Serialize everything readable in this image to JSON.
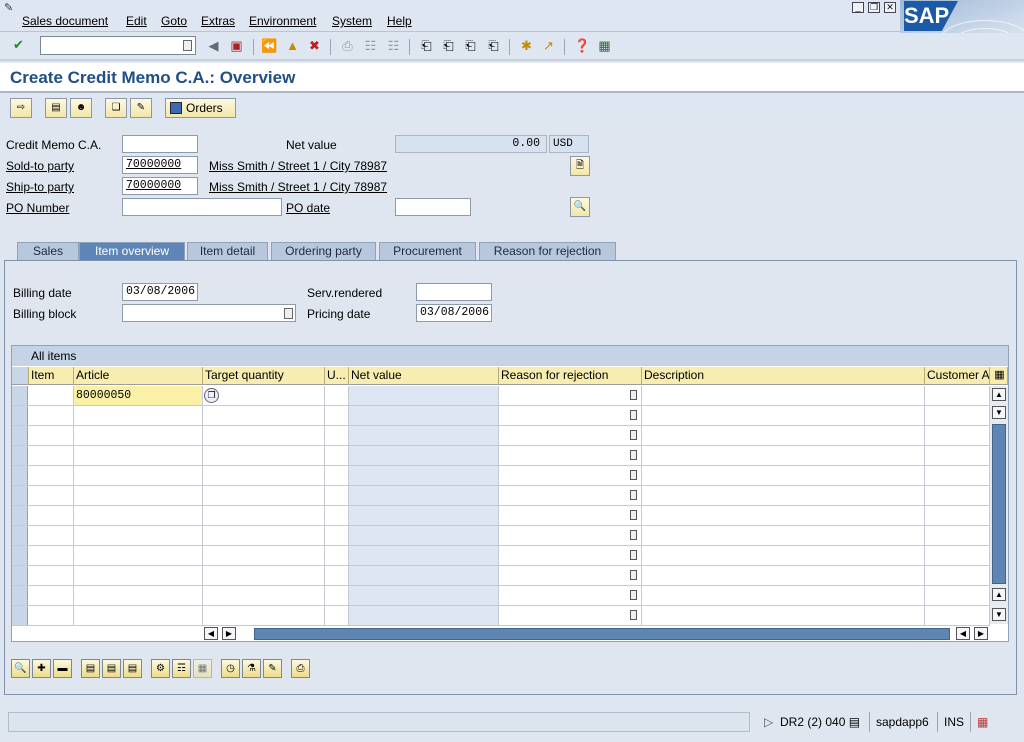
{
  "menu": {
    "items": [
      "Sales document",
      "Edit",
      "Goto",
      "Extras",
      "Environment",
      "System",
      "Help"
    ]
  },
  "logo": "SAP",
  "title": "Create Credit Memo C.A.: Overview",
  "app_toolbar": {
    "orders_label": "Orders"
  },
  "header": {
    "credit_memo_label": "Credit Memo C.A.",
    "credit_memo_value": "",
    "net_value_label": "Net value",
    "net_value": "0.00",
    "currency": "USD",
    "sold_to_label": "Sold-to party",
    "sold_to_value": "70000000",
    "sold_to_text": "Miss Smith / Street 1 / City 78987",
    "ship_to_label": "Ship-to party",
    "ship_to_value": "70000000",
    "ship_to_text": "Miss Smith / Street 1 / City 78987",
    "po_number_label": "PO Number",
    "po_number_value": "",
    "po_date_label": "PO date",
    "po_date_value": ""
  },
  "tabs": [
    "Sales",
    "Item overview",
    "Item detail",
    "Ordering party",
    "Procurement",
    "Reason for rejection"
  ],
  "active_tab": "Item overview",
  "item_overview": {
    "billing_date_label": "Billing date",
    "billing_date": "03/08/2006",
    "billing_block_label": "Billing block",
    "billing_block": "",
    "serv_rendered_label": "Serv.rendered",
    "serv_rendered": "",
    "pricing_date_label": "Pricing date",
    "pricing_date": "03/08/2006"
  },
  "table": {
    "title": "All items",
    "columns": [
      "Item",
      "Article",
      "Target quantity",
      "U...",
      "Net value",
      "Reason for rejection",
      "Description",
      "Customer A"
    ],
    "first_row_article": "80000050"
  },
  "status": {
    "system": "DR2 (2) 040",
    "server": "sapdapp6",
    "mode": "INS"
  }
}
